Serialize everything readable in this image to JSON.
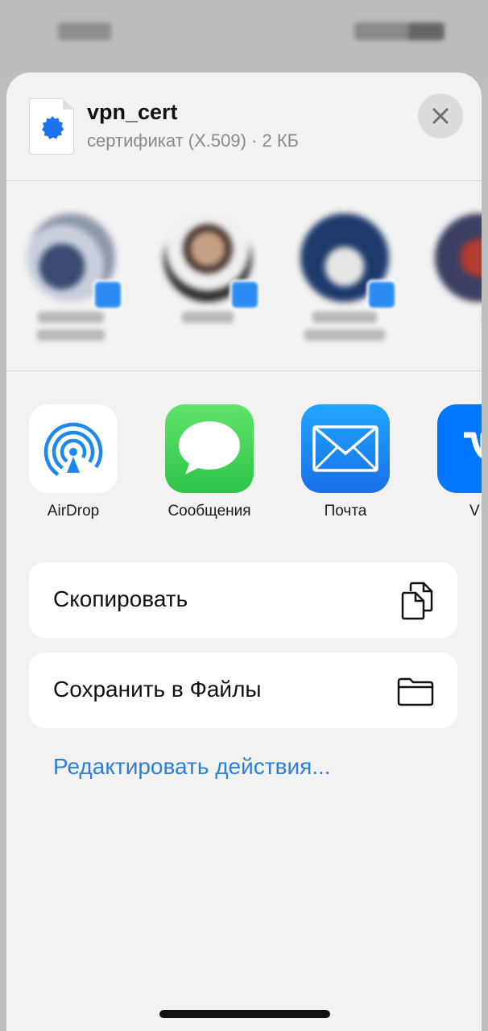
{
  "file": {
    "name": "vpn_cert",
    "subtitle": "сертификат (X.509) · 2 КБ",
    "icon": "certificate-seal-icon"
  },
  "close": {
    "icon": "close-icon"
  },
  "apps": [
    {
      "label": "AirDrop",
      "icon": "airdrop-icon",
      "color": "#1e88f2"
    },
    {
      "label": "Сообщения",
      "icon": "messages-icon",
      "color": "#34c759"
    },
    {
      "label": "Почта",
      "icon": "mail-icon",
      "color": "#1f8ff5"
    },
    {
      "label": "V",
      "icon": "vk-icon",
      "color": "#0077ff"
    }
  ],
  "actions": [
    {
      "label": "Скопировать",
      "icon": "copy-icon"
    },
    {
      "label": "Сохранить в Файлы",
      "icon": "folder-icon"
    }
  ],
  "edit_actions": "Редактировать действия...",
  "colors": {
    "link": "#2e7fd8",
    "sheet_background": "#f2f2f2",
    "secondary_text": "#8a8a8e"
  }
}
